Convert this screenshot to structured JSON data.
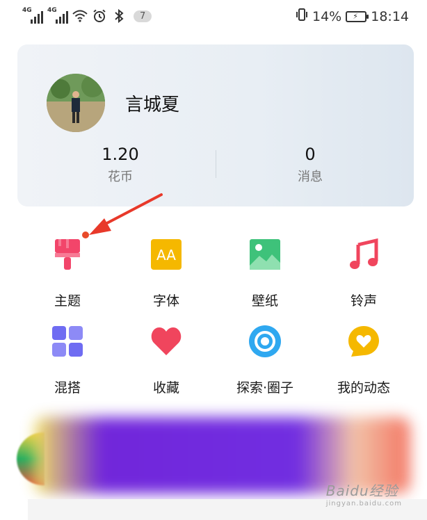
{
  "status_bar": {
    "sim1_net": "4G",
    "sim2_net": "4G",
    "notification_count": "7",
    "battery_percent": "14%",
    "time": "18:14"
  },
  "profile": {
    "username": "言城夏",
    "coins_value": "1.20",
    "coins_label": "花币",
    "messages_value": "0",
    "messages_label": "消息"
  },
  "grid": [
    {
      "label": "主题",
      "icon": "paint-brush-icon",
      "color": "#f2456a"
    },
    {
      "label": "字体",
      "icon": "font-aa-icon",
      "color": "#f5b800"
    },
    {
      "label": "壁纸",
      "icon": "wallpaper-landscape-icon",
      "color": "#3ec27a"
    },
    {
      "label": "铃声",
      "icon": "music-note-icon",
      "color": "#f0455d"
    },
    {
      "label": "混搭",
      "icon": "four-squares-icon",
      "color": "#6f6cf2"
    },
    {
      "label": "收藏",
      "icon": "heart-icon",
      "color": "#f0455d"
    },
    {
      "label": "探索·圈子",
      "icon": "explore-circle-icon",
      "color": "#2fa8f0"
    },
    {
      "label": "我的动态",
      "icon": "heart-chat-bubble-icon",
      "color": "#f5b800"
    }
  ],
  "annotation": {
    "arrow_color": "#e8392a"
  },
  "watermark": {
    "text": "Baidu经验",
    "url": "jingyan.baidu.com"
  }
}
